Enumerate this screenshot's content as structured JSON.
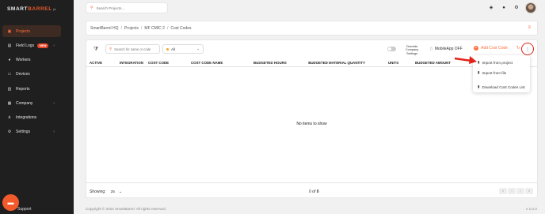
{
  "brand": {
    "logo_part1": "SMART",
    "logo_part2": "BARREL"
  },
  "sidebar": {
    "items": [
      {
        "label": "Projects",
        "icon": "folder-icon"
      },
      {
        "label": "Field Logs",
        "icon": "clipboard-icon",
        "badge": "NEW"
      },
      {
        "label": "Workers",
        "icon": "user-icon"
      },
      {
        "label": "Devices",
        "icon": "device-icon"
      },
      {
        "label": "Reports",
        "icon": "chart-icon"
      },
      {
        "label": "Company",
        "icon": "building-icon"
      },
      {
        "label": "Integrations",
        "icon": "integrations-icon"
      },
      {
        "label": "Settings",
        "icon": "gear-icon"
      }
    ],
    "support_label": "Support"
  },
  "top": {
    "search_placeholder": "Search Projects..."
  },
  "breadcrumb": [
    "SmartBarrel HQ",
    "Projects",
    "MF CMIC 2",
    "Cost Codes"
  ],
  "toolbar": {
    "search_placeholder": "Search for name or code",
    "filter_value": "All",
    "override_label": "Override Company Settings",
    "mobile_app_label": "MobileApp OFF",
    "add_label": "Add Cost Code"
  },
  "table": {
    "columns": [
      "ACTIVE",
      "INTEGRATION",
      "COST CODE",
      "COST CODE NAME",
      "BUDGETED HOURS",
      "BUDGETED MATERIAL QUANTITY",
      "UNITS",
      "BUDGETED AMOUNT"
    ],
    "empty_message": "No items to show"
  },
  "menu": {
    "items": [
      "Import from project",
      "Import from file",
      "Download Cost Codes List"
    ]
  },
  "footer": {
    "showing_label": "Showing:",
    "page_size": "25",
    "count_prefix": "0 of ",
    "count_total": "0"
  },
  "copyright": "Copyright © 2024 SmartBarrel. All rights reserved.",
  "version": "v 1.0.3",
  "colors": {
    "accent": "#ff6e3a",
    "sidebar_bg": "#1f1f1f",
    "highlight_red": "#e2231a"
  }
}
